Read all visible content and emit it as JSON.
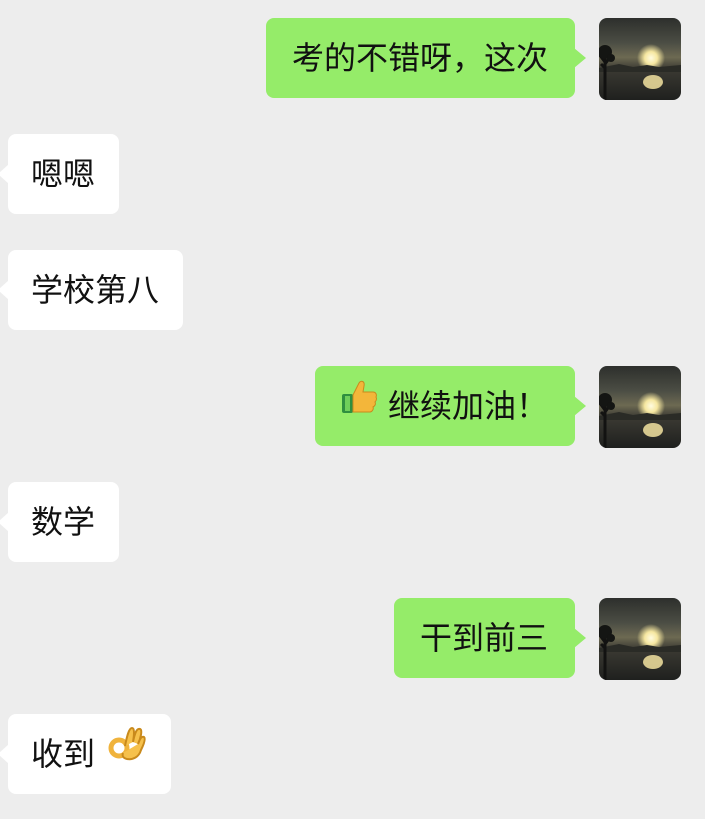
{
  "messages": [
    {
      "direction": "outgoing",
      "text": "考的不错呀，这次",
      "icon": null
    },
    {
      "direction": "incoming",
      "text": "嗯嗯",
      "icon": null
    },
    {
      "direction": "incoming",
      "text": "学校第八",
      "icon": null
    },
    {
      "direction": "outgoing",
      "text": "继续加油！",
      "icon": "thumbs-up-emoji"
    },
    {
      "direction": "incoming",
      "text": "数学",
      "icon": null
    },
    {
      "direction": "outgoing",
      "text": "干到前三",
      "icon": null
    },
    {
      "direction": "incoming",
      "text": "收到",
      "icon": "ok-hand-emoji"
    }
  ],
  "colors": {
    "background": "#ededed",
    "outgoing_bubble": "#95ec69",
    "incoming_bubble": "#ffffff",
    "text": "#111111"
  }
}
